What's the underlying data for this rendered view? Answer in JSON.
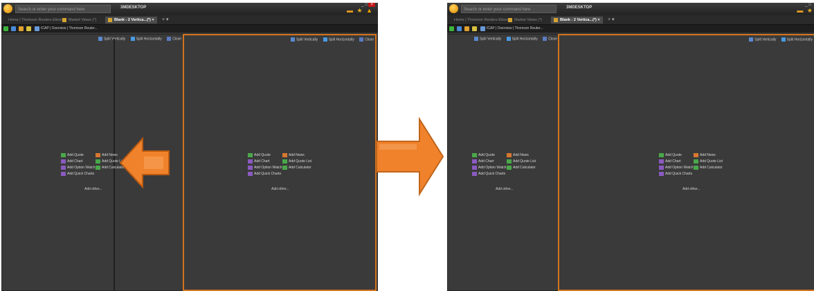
{
  "app": {
    "search_placeholder": "Search or enter your command here",
    "name": "3MDESKTOP",
    "tabs": [
      {
        "label": "Home | Thomson Reuters Eikon",
        "active": false
      },
      {
        "label": "Market Views (*)",
        "active": false
      },
      {
        "label": "Blank - 2 Vertica...(*)",
        "active": true
      }
    ],
    "tab_close": "×",
    "tab_add": "+ ▾",
    "toolbar_label": "ICAP | Overview | Thomson Reuter...",
    "window_controls": {
      "minimize": "_",
      "maximize": "□",
      "close": "×"
    }
  },
  "panel_toolbar": {
    "split_vertically": "Split Vertically",
    "split_horizontally": "Split Horizontally",
    "close": "Close"
  },
  "quick_menu": {
    "add_quote": "Add Quote",
    "add_news": "Add News",
    "add_chart": "Add Chart",
    "add_quote_list": "Add Quote List",
    "add_option_watch": "Add Option Watch",
    "add_calculator": "Add Calculator",
    "add_quick_charts": "Add Quick Charts",
    "add_other": "Add other..."
  },
  "colors": {
    "accent_orange": "#d4731c",
    "arrow_orange": "#f0822c",
    "panel_bg": "#3a3a3a"
  },
  "icons": {
    "app_logo": "app-logo-icon",
    "favorites": "star-icon",
    "alert": "warning-icon",
    "arrow_left": "arrow-left-icon",
    "arrow_right": "arrow-right-icon"
  }
}
